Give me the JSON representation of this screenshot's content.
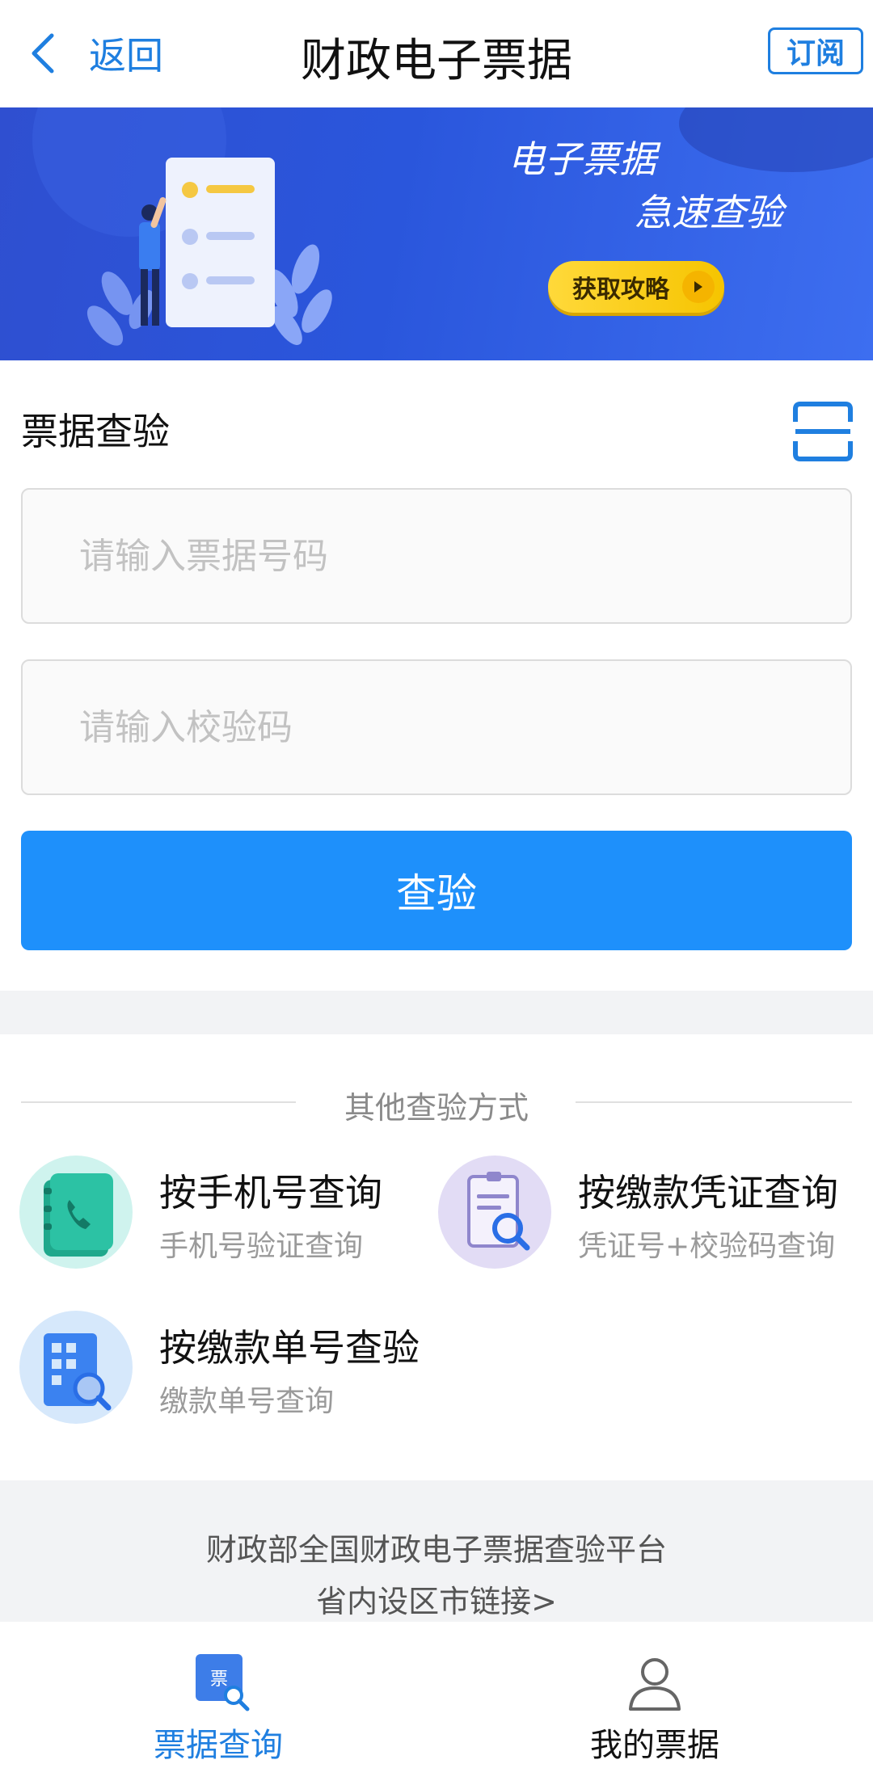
{
  "header": {
    "back_label": "返回",
    "title": "财政电子票据",
    "subscribe_label": "订阅"
  },
  "banner": {
    "line1": "电子票据",
    "line2": "急速查验",
    "button_label": "获取攻略"
  },
  "verify": {
    "section_title": "票据查验",
    "number_placeholder": "请输入票据号码",
    "code_placeholder": "请输入校验码",
    "submit_label": "查验"
  },
  "others": {
    "divider_label": "其他查验方式",
    "methods": [
      {
        "title": "按手机号查询",
        "subtitle": "手机号验证查询"
      },
      {
        "title": "按缴款凭证查询",
        "subtitle": "凭证号+校验码查询"
      },
      {
        "title": "按缴款单号查验",
        "subtitle": "缴款单号查询"
      }
    ]
  },
  "footer": {
    "platform_link": "财政部全国财政电子票据查验平台",
    "city_link": "省内设区市链接>"
  },
  "tabbar": {
    "items": [
      {
        "label": "票据查询",
        "icon_text": "票"
      },
      {
        "label": "我的票据"
      }
    ]
  },
  "colors": {
    "accent": "#1e90fb",
    "link": "#1f7fe0",
    "banner": "#2f56dc"
  }
}
